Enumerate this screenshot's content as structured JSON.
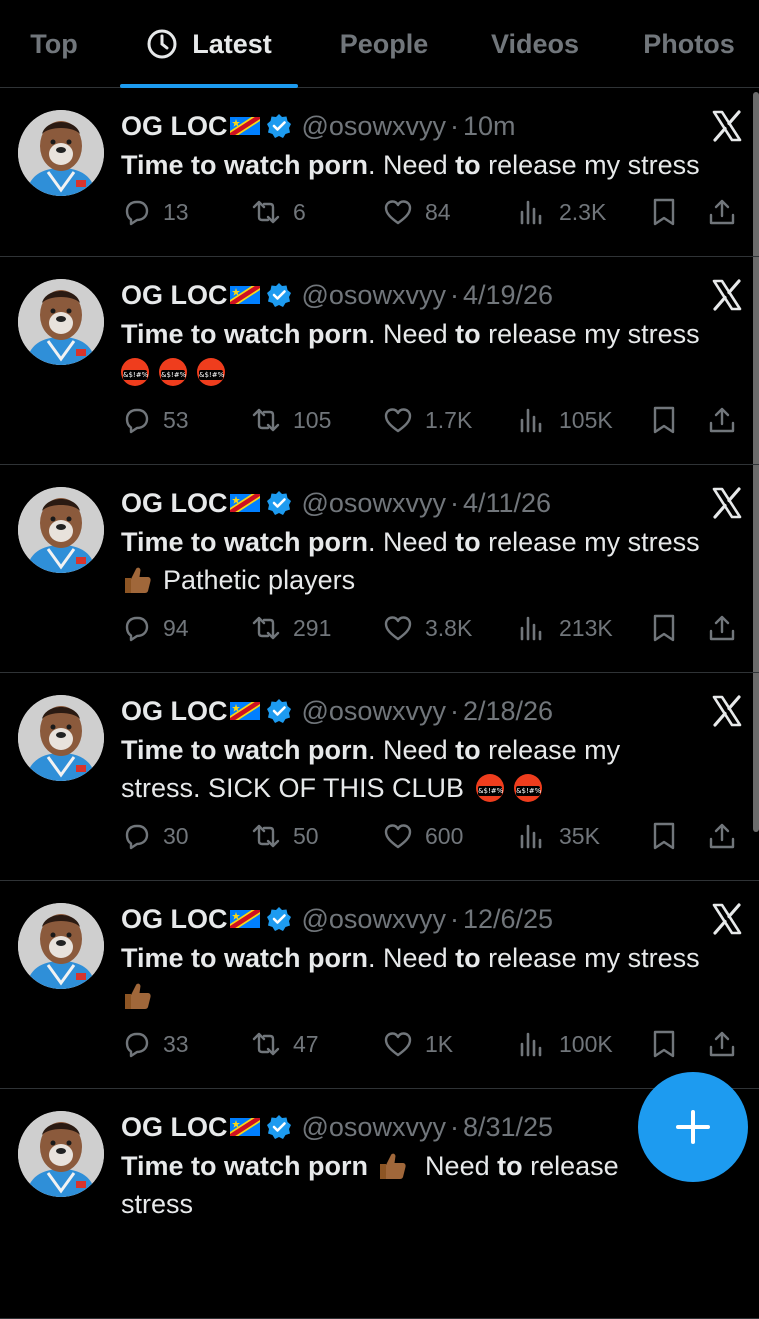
{
  "tabs": [
    {
      "label": "Top",
      "active": false
    },
    {
      "label": "Latest",
      "active": true
    },
    {
      "label": "People",
      "active": false
    },
    {
      "label": "Videos",
      "active": false
    },
    {
      "label": "Photos",
      "active": false
    }
  ],
  "tweets": [
    {
      "name": "OG LOC",
      "handle": "@osowxvyy",
      "sep": "·",
      "time": "10m",
      "bold1": "Time to watch porn",
      "mid1": ". Need ",
      "bold2": "to",
      "rest": " release my stress",
      "replies": "13",
      "reposts": "6",
      "likes": "84",
      "views": "2.3K"
    },
    {
      "name": "OG LOC",
      "handle": "@osowxvyy",
      "sep": "·",
      "time": "4/19/26",
      "bold1": "Time to watch porn",
      "mid1": ". Need ",
      "bold2": "to",
      "rest": " release my stress",
      "replies": "53",
      "reposts": "105",
      "likes": "1.7K",
      "views": "105K"
    },
    {
      "name": "OG LOC",
      "handle": "@osowxvyy",
      "sep": "·",
      "time": "4/11/26",
      "bold1": "Time to watch porn",
      "mid1": ". Need ",
      "bold2": "to",
      "rest": " release my stress",
      "line2": "Pathetic players",
      "replies": "94",
      "reposts": "291",
      "likes": "3.8K",
      "views": "213K"
    },
    {
      "name": "OG LOC",
      "handle": "@osowxvyy",
      "sep": "·",
      "time": "2/18/26",
      "bold1": "Time to watch porn",
      "mid1": ". Need ",
      "bold2": "to",
      "rest": " release my",
      "line2": "stress. SICK OF THIS CLUB",
      "replies": "30",
      "reposts": "50",
      "likes": "600",
      "views": "35K"
    },
    {
      "name": "OG LOC",
      "handle": "@osowxvyy",
      "sep": "·",
      "time": "12/6/25",
      "bold1": "Time to watch porn",
      "mid1": ". Need ",
      "bold2": "to",
      "rest": " release my stress",
      "replies": "33",
      "reposts": "47",
      "likes": "1K",
      "views": "100K"
    },
    {
      "name": "OG LOC",
      "handle": "@osowxvyy",
      "sep": "·",
      "time": "8/31/25",
      "bold1": "Time to watch porn",
      "mid1": " Need ",
      "bold2": "to",
      "rest": " release",
      "line2": "stress"
    }
  ],
  "colors": {
    "accent": "#1d9bf0",
    "background": "#000000",
    "secondary_text": "#71767b"
  }
}
